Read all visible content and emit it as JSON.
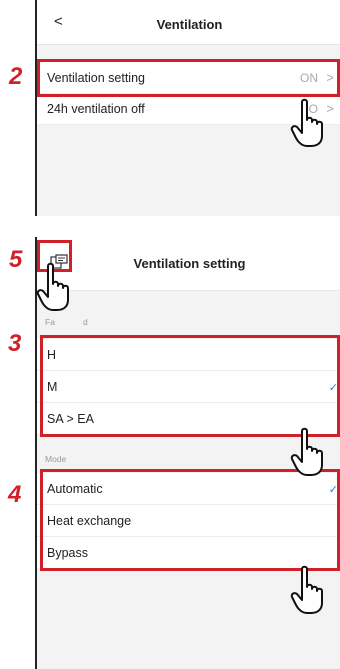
{
  "panel1": {
    "title": "Ventilation",
    "back_icon": "chevron-left-icon",
    "rows": [
      {
        "label": "Ventilation setting",
        "value": "ON",
        "chevron": "chevron-right-icon"
      },
      {
        "label": "24h ventilation off",
        "value": "O",
        "chevron": "chevron-right-icon"
      }
    ]
  },
  "panel2": {
    "title": "Ventilation setting",
    "icon": "remote-controller-icon",
    "fan_speed": {
      "section_label_left": "Fa",
      "section_label_right": "d",
      "options": [
        {
          "label": "H",
          "selected": false
        },
        {
          "label": "M",
          "selected": true
        },
        {
          "label": "SA > EA",
          "selected": false
        }
      ]
    },
    "mode": {
      "section_label": "Mode",
      "options": [
        {
          "label": "Automatic",
          "selected": true
        },
        {
          "label": "Heat exchange",
          "selected": false
        },
        {
          "label": "Bypass",
          "selected": false
        }
      ]
    }
  },
  "steps": [
    "2",
    "5",
    "3",
    "4"
  ],
  "colors": {
    "highlight": "#d0202a",
    "check": "#2a7de1"
  },
  "check_glyph": "✓"
}
